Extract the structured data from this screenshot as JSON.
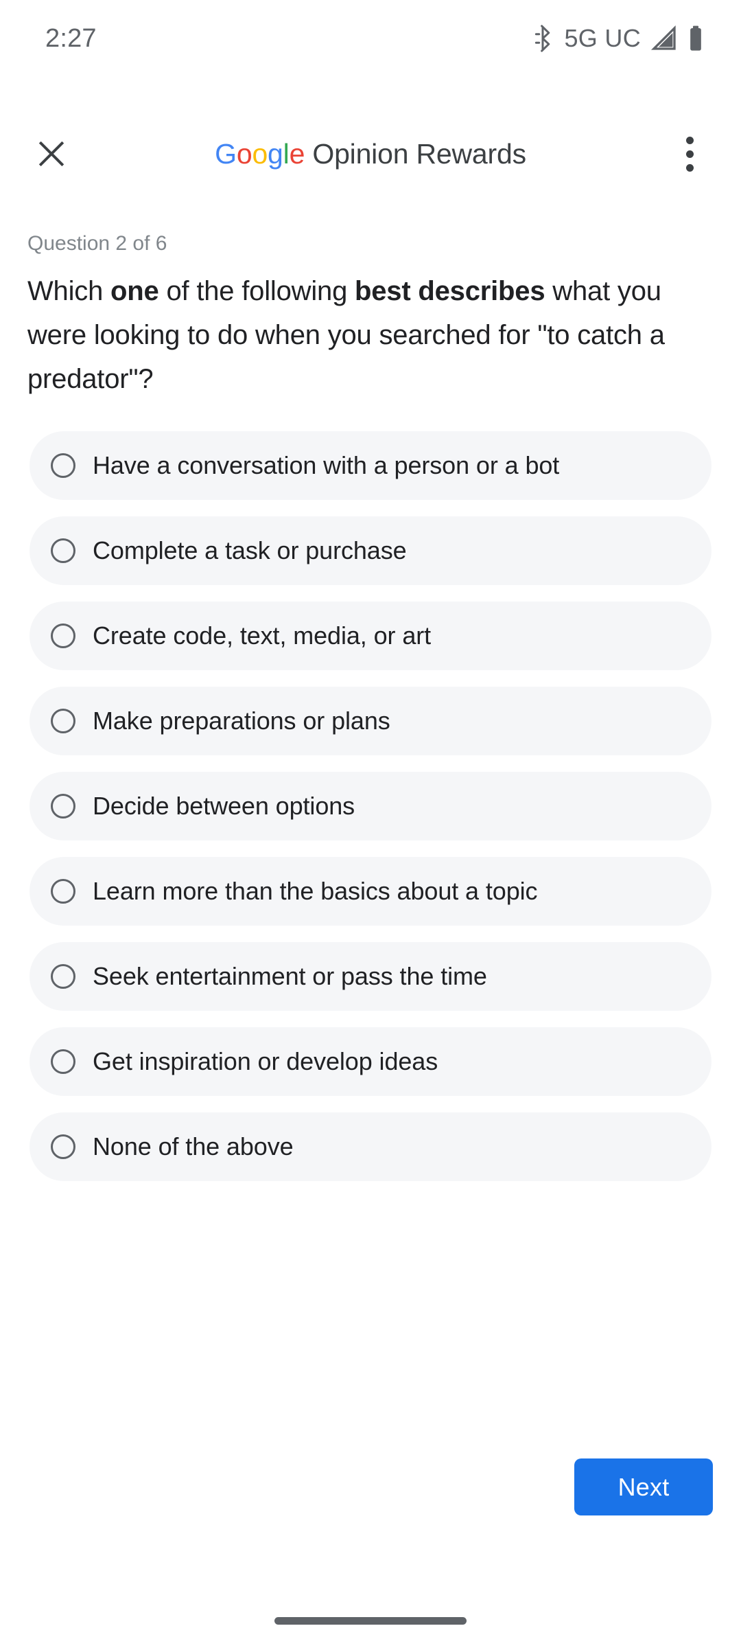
{
  "status_bar": {
    "time": "2:27",
    "network_label": "5G UC",
    "bluetooth_icon": "bluetooth-icon",
    "signal_icon": "signal-bars-icon",
    "battery_icon": "battery-full-icon"
  },
  "app_bar": {
    "close_icon": "close-icon",
    "overflow_icon": "more-vert-icon",
    "logo_letters": {
      "g1": "G",
      "o1": "o",
      "o2": "o",
      "g2": "g",
      "l": "l",
      "e": "e"
    },
    "title_rest": " Opinion Rewards",
    "colors": {
      "blue": "#4285F4",
      "red": "#EA4335",
      "yellow": "#FBBC05",
      "green": "#34A853",
      "title_gray": "#3c4043"
    }
  },
  "question": {
    "meta": "Question 2 of 6",
    "parts": [
      {
        "text": "Which ",
        "bold": false
      },
      {
        "text": "one",
        "bold": true
      },
      {
        "text": " of the following ",
        "bold": false
      },
      {
        "text": "best describes",
        "bold": true
      },
      {
        "text": " what you were looking to do when you searched for \"to catch a predator\"?",
        "bold": false
      }
    ],
    "full_text": "Which one of the following best describes what you were looking to do when you searched for \"to catch a predator\"?"
  },
  "options": [
    {
      "label": "Have a conversation with a person or a bot",
      "selected": false
    },
    {
      "label": "Complete a task or purchase",
      "selected": false
    },
    {
      "label": "Create code, text, media, or art",
      "selected": false
    },
    {
      "label": "Make preparations or plans",
      "selected": false
    },
    {
      "label": "Decide between options",
      "selected": false
    },
    {
      "label": "Learn more than the basics about a topic",
      "selected": false
    },
    {
      "label": "Seek entertainment or pass the time",
      "selected": false
    },
    {
      "label": "Get inspiration or develop ideas",
      "selected": false
    },
    {
      "label": "None of the above",
      "selected": false
    }
  ],
  "footer": {
    "next_label": "Next",
    "next_color": "#1a73e8"
  }
}
